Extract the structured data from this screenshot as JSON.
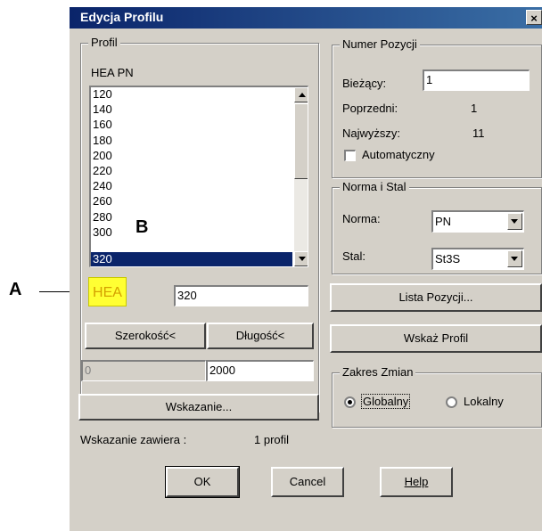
{
  "dialog": {
    "title": "Edycja Profilu",
    "close_glyph": "×"
  },
  "profil": {
    "legend": "Profil",
    "family": "HEA PN",
    "list_items": [
      "120",
      "140",
      "160",
      "180",
      "200",
      "220",
      "240",
      "260",
      "280",
      "300",
      "320"
    ],
    "selected_index": 10,
    "hea_label": "HEA",
    "size_value": "320",
    "width_button": "Szerokość<",
    "length_button": "Długość<",
    "width_value": "0",
    "length_value": "2000",
    "pointing_button": "Wskazanie..."
  },
  "status": {
    "label": "Wskazanie zawiera :",
    "value": "1 profil"
  },
  "numer": {
    "legend": "Numer Pozycji",
    "current_label": "Bieżący:",
    "current_value": "1",
    "previous_label": "Poprzedni:",
    "previous_value": "1",
    "highest_label": "Najwyższy:",
    "highest_value": "11",
    "auto_label": "Automatyczny",
    "auto_checked": false
  },
  "norma": {
    "legend": "Norma i Stal",
    "norm_label": "Norma:",
    "norm_value": "PN",
    "steel_label": "Stal:",
    "steel_value": "St3S"
  },
  "lista_button": "Lista Pozycji...",
  "wskaz_button": "Wskaż Profil",
  "zakres": {
    "legend": "Zakres Zmian",
    "global_label": "Globalny",
    "local_label": "Lokalny",
    "selected": "global"
  },
  "buttons": {
    "ok": "OK",
    "cancel": "Cancel",
    "help": "Help"
  },
  "annotations": {
    "a": "A",
    "b": "B"
  }
}
